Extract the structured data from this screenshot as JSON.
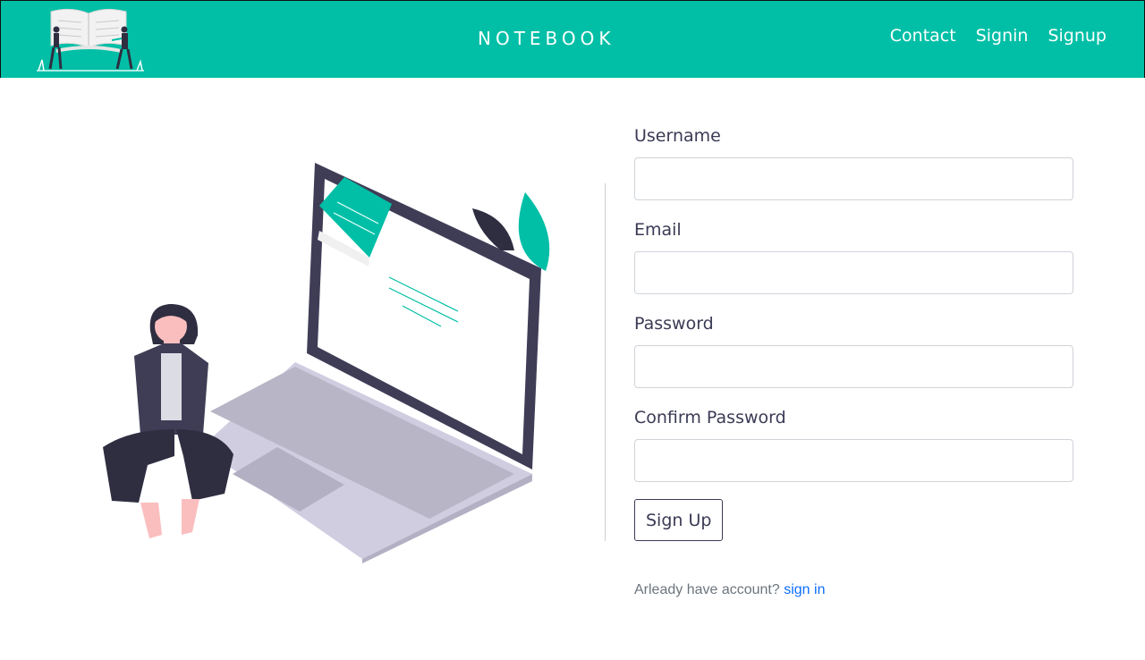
{
  "navbar": {
    "brand": "NOTEBOOK",
    "links": [
      "Contact",
      "Signin",
      "Signup"
    ],
    "color": "#00bfa6"
  },
  "form": {
    "fields": [
      {
        "label": "Username",
        "value": ""
      },
      {
        "label": "Email",
        "value": ""
      },
      {
        "label": "Password",
        "value": ""
      },
      {
        "label": "Confirm Password",
        "value": ""
      }
    ],
    "submit_label": "Sign Up"
  },
  "footer": {
    "prompt": "Arleady have account? ",
    "link": "sign in"
  },
  "icons": {
    "logo": "open-book-logo-icon",
    "illustration": "woman-with-laptop-illustration"
  }
}
